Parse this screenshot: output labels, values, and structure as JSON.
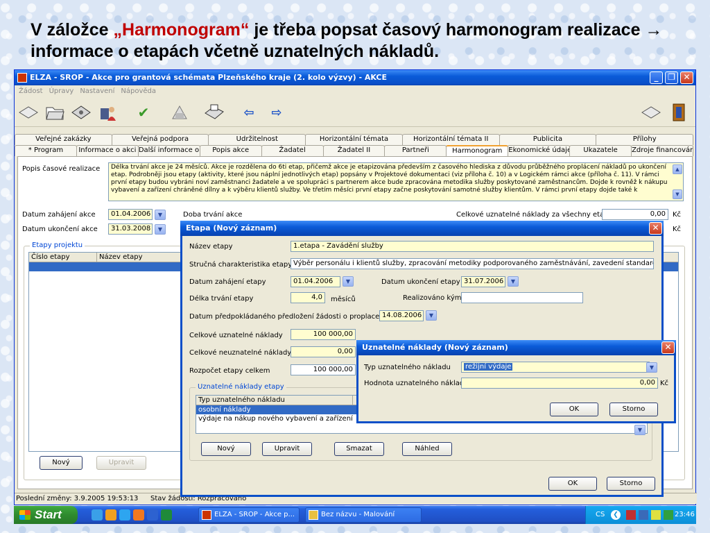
{
  "slide": {
    "title_pre": "V záložce ",
    "title_hl": "„Harmonogram“",
    "title_post": " je třeba popsat časový harmonogram realizace → informace o etapách včetně uznatelných nákladů."
  },
  "window": {
    "title": "ELZA - SROP - Akce pro grantová schémata Plzeňského kraje (2. kolo výzvy) - AKCE",
    "min": "_",
    "max": "❐",
    "close": "✕"
  },
  "menu": [
    "Žádost",
    "Úpravy",
    "Nastavení",
    "Nápověda"
  ],
  "toolbar": {
    "icons": [
      "open-icon",
      "folder-icon",
      "save-disk-icon",
      "user-icon",
      "check-icon",
      "dialog-icon",
      "print-icon",
      "back-arrow-icon",
      "forward-arrow-icon",
      "document-icon",
      "exit-door-icon"
    ],
    "back": "⇦",
    "forward": "⇨",
    "check": "✔"
  },
  "tabs_top": [
    "Veřejné zakázky",
    "Veřejná podpora",
    "Udržitelnost",
    "Horizontální témata",
    "Horizontální témata II",
    "Publicita",
    "Přílohy"
  ],
  "tabs_bottom": [
    "* Program",
    "Informace o akci",
    "Další informace o akci",
    "Popis akce",
    "Žadatel",
    "Žadatel II",
    "Partneři",
    "Harmonogram",
    "Ekonomické údaje",
    "Ukazatele",
    "Zdroje financování"
  ],
  "main": {
    "popis_label": "Popis časové realizace",
    "popis_text": "Délka trvání akce je 24 měsíců. Akce je rozdělena do 6ti etap, přičemž akce je etapizována především z časového hlediska z důvodu průběžného proplácení nákladů po ukončení etap. Podrobněji jsou etapy (aktivity, které jsou náplní jednotlivých etap) popsány v Projektové dokumentaci (viz příloha č. 10) a v Logickém rámci akce (příloha č. 11). V rámci první etapy budou vybráni noví zaměstnanci žadatele a ve spolupráci s partnerem akce bude zpracována metodika služby poskytované zaměstnancům. Dojde k rovněž k nákupu vybavení a zařízení chráněné dílny a k výběru klientů služby. Ve třetím měsíci první etapy začne poskytování samotné služby klientům. V rámci první etapy dojde také k",
    "datum_zahajeni_label": "Datum zahájení akce",
    "datum_zahajeni": "01.04.2006",
    "datum_ukonceni_label": "Datum ukončení akce",
    "datum_ukonceni": "31.03.2008",
    "doba_trvani_label": "Doba trvání akce",
    "celkove_label": "Celkové uznatelné náklady za všechny etapy",
    "celkove_value": "0,00",
    "kc": "Kč",
    "etapy_group": "Etapy projektu",
    "etapy_cols": [
      "Číslo etapy",
      "Název etapy"
    ],
    "btn_novy": "Nový",
    "btn_upravit": "Upravit"
  },
  "dialog_etapa": {
    "title": "Etapa (Nový záznam)",
    "nazev_label": "Název etapy",
    "nazev": "1.etapa - Zavádění služby",
    "strucna_label": "Stručná charakteristika etapy",
    "strucna": "Výběr personálu i klientů služby, zpracování metodiky podporovaného zaměstnávání, zavedení standardů sociální",
    "zahajeni_label": "Datum zahájení etapy",
    "zahajeni": "01.04.2006",
    "ukonceni_label": "Datum ukončení etapy",
    "ukonceni": "31.07.2006",
    "delka_label": "Délka trvání etapy",
    "delka": "4,0",
    "mesicu": "měsíců",
    "realizovano_label": "Realizováno kým",
    "predlozeni_label": "Datum předpokládaného předložení žádosti o proplacení",
    "predlozeni": "14.08.2006",
    "uznatelne_label": "Celkové uznatelné náklady",
    "uznatelne": "100 000,00",
    "neuznatelne_label": "Celkové neuznatelné náklady",
    "neuznatelne": "0,00",
    "rozpocet_label": "Rozpočet etapy celkem",
    "rozpocet": "100 000,00",
    "group": "Uznatelné náklady etapy",
    "col": "Typ uznatelného nákladu",
    "rows": [
      "osobní náklady",
      "výdaje na nákup nového vybavení a zařízení"
    ],
    "btn_novy": "Nový",
    "btn_upravit": "Upravit",
    "btn_smazat": "Smazat",
    "btn_nahled": "Náhled",
    "btn_ok": "OK",
    "btn_storno": "Storno"
  },
  "dialog_naklady": {
    "title": "Uznatelné náklady (Nový záznam)",
    "typ_label": "Typ uznatelného nákladu",
    "typ": "režijní výdaje",
    "hodnota_label": "Hodnota uznatelného nákladu",
    "hodnota": "0,00",
    "kc": "Kč",
    "btn_ok": "OK",
    "btn_storno": "Storno"
  },
  "status": {
    "posledni": "Poslední změny: 3.9.2005 19:53:13",
    "stav": "Stav žádosti: Rozpracováno"
  },
  "taskbar": {
    "start": "Start",
    "task1": "ELZA - SROP - Akce p...",
    "task2": "Bez názvu - Malování",
    "lang": "CS",
    "clock": "23:46"
  }
}
